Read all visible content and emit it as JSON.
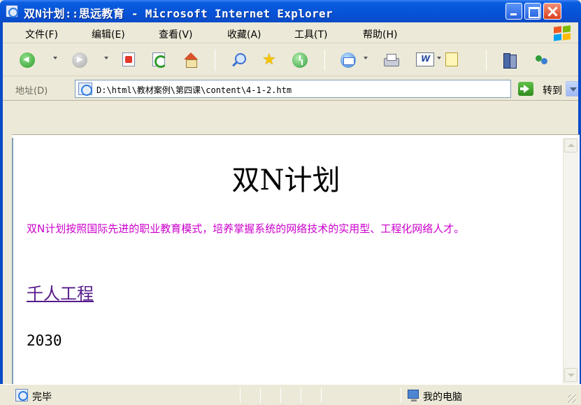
{
  "window": {
    "title": "双N计划::思远教育 - Microsoft Internet Explorer"
  },
  "menu": {
    "items": [
      "文件(F)",
      "编辑(E)",
      "查看(V)",
      "收藏(A)",
      "工具(T)",
      "帮助(H)"
    ]
  },
  "toolbar": {
    "icons": [
      "back-icon",
      "forward-icon",
      "stop-icon",
      "refresh-icon",
      "home-icon",
      "search-icon",
      "favorites-icon",
      "history-icon",
      "mail-icon",
      "print-icon",
      "edit-icon",
      "discuss-icon",
      "research-icon",
      "messenger-icon"
    ]
  },
  "address": {
    "label": "地址(D)",
    "value": "D:\\html\\教材案例\\第四课\\content\\4-1-2.htm",
    "go_label": "转到"
  },
  "page": {
    "heading": "双N计划",
    "paragraph": "双N计划按照国际先进的职业教育模式，培养掌握系统的网络技术的实用型、工程化网络人才。",
    "link": "千人工程",
    "number": "2030"
  },
  "status": {
    "text": "完毕",
    "zone": "我的电脑"
  },
  "colors": {
    "titlebar": "#0653d8",
    "paragraph": "#cc00cc",
    "link": "#551a8b",
    "chrome": "#ece9d8"
  }
}
